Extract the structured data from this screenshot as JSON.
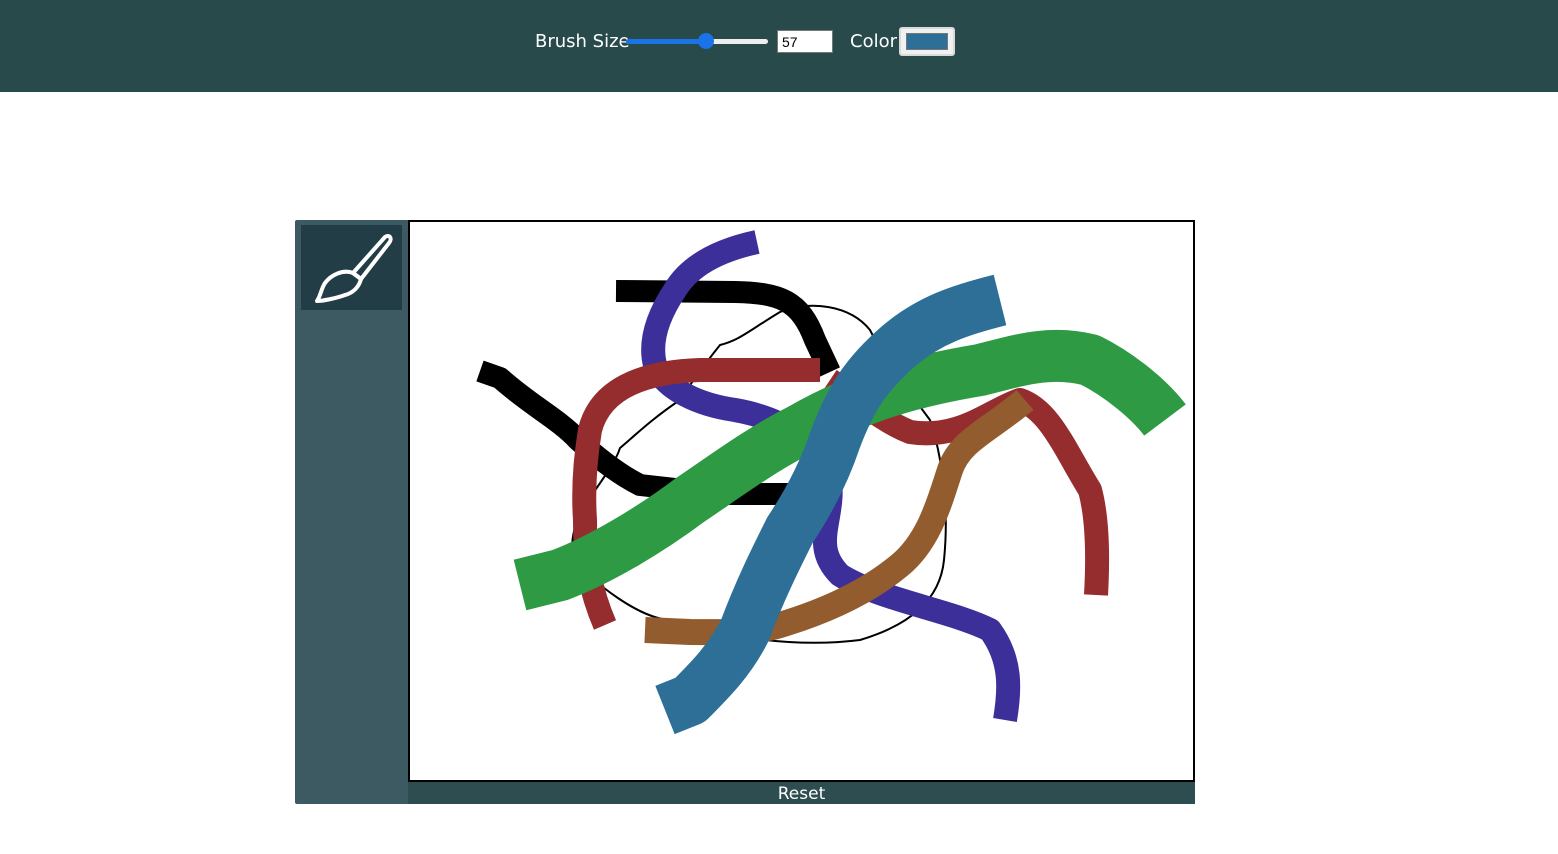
{
  "toolbar": {
    "brush_size_label": "Brush Size",
    "brush_size_value": "57",
    "brush_size_min": 1,
    "brush_size_max": 100,
    "color_label": "Color",
    "color_value": "#2e6f97"
  },
  "sidebar": {
    "tool": {
      "icon": "paintbrush-icon"
    }
  },
  "canvas": {
    "background": "#ffffff",
    "stroke_colors": {
      "black": "#000000",
      "purple": "#3d2f9a",
      "red": "#952c2e",
      "brown": "#935c2e",
      "green": "#2f9a44",
      "blue": "#2e6f97"
    }
  },
  "reset_label": "Reset",
  "colors": {
    "topbar": "#284a4b",
    "sidebar": "#3d5a62",
    "tool_button": "#223d45",
    "accent": "#1a73e8"
  }
}
